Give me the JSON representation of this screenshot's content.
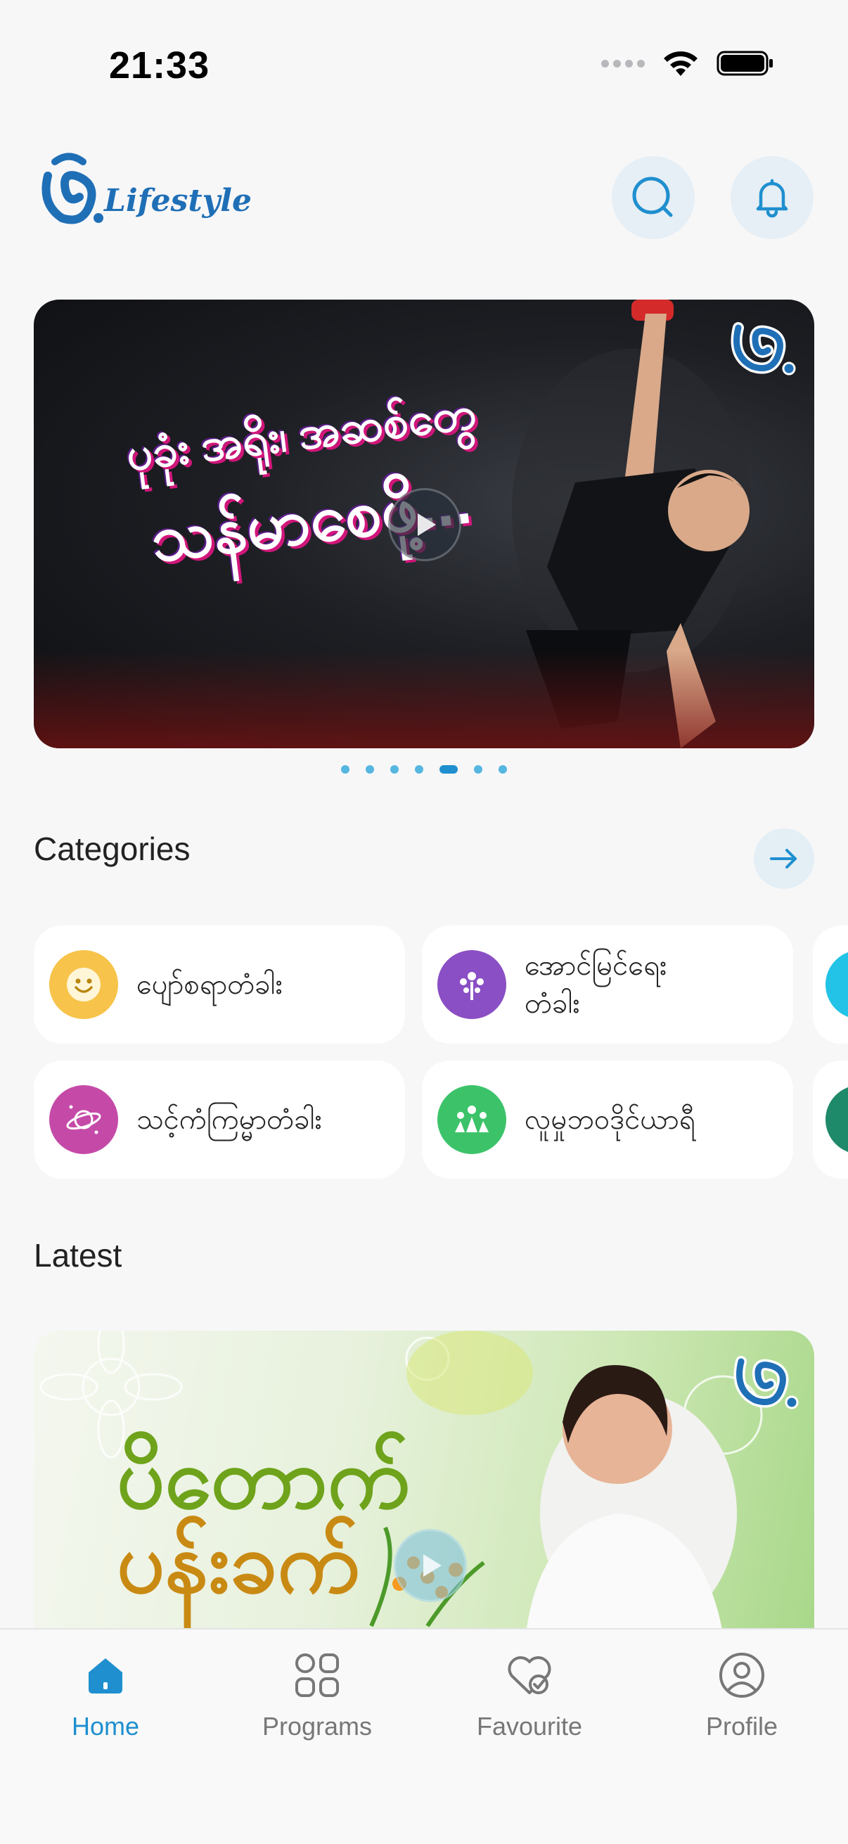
{
  "status_bar": {
    "time": "21:33"
  },
  "header": {
    "logo_text": "Lifestyle"
  },
  "banner": {
    "title_line1": "ပုခုံး အရိုး၊ အဆစ်တွေ",
    "title_line2": "သန်မာစေဖို့..."
  },
  "carousel": {
    "count": 7,
    "active_index": 4
  },
  "categories": {
    "title": "Categories",
    "items": [
      {
        "label": "ပျော်စရာတံခါး",
        "color": "#f7c34a"
      },
      {
        "label": "အောင်မြင်ရေး\nတံခါး",
        "color": "#8a4fc4"
      },
      {
        "label": "သင့်ကံကြမ္မာတံခါး",
        "color": "#c54aa8"
      },
      {
        "label": "လူမှုဘဝဒိုင်ယာရီ",
        "color": "#3cc36a"
      }
    ]
  },
  "latest": {
    "title": "Latest",
    "card_line1": "ပိတောက်",
    "card_line2": "ပန်းခက်"
  },
  "tab_bar": {
    "tabs": [
      {
        "label": "Home",
        "icon": "home-icon",
        "active": true
      },
      {
        "label": "Programs",
        "icon": "grid-icon",
        "active": false
      },
      {
        "label": "Favourite",
        "icon": "heart-check-icon",
        "active": false
      },
      {
        "label": "Profile",
        "icon": "user-circle-icon",
        "active": false
      }
    ]
  },
  "colors": {
    "accent": "#1f8fcf",
    "banner_title_shadow": "#d0167a"
  }
}
